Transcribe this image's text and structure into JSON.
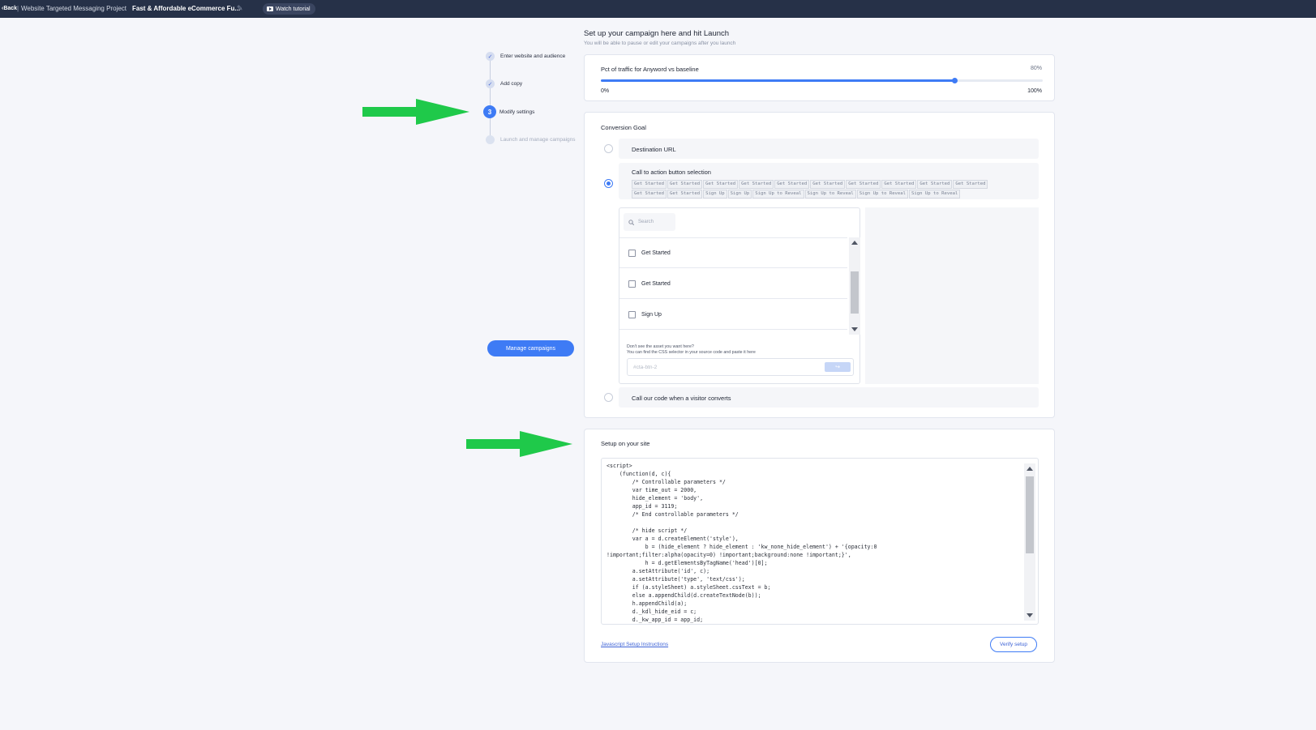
{
  "topbar": {
    "back": "‹Back",
    "separator": "|",
    "project": "Website Targeted Messaging Project",
    "campaign": "Fast & Affordable eCommerce Fu...",
    "watch_tutorial": "Watch tutorial",
    "icons": [
      "pencil-icon",
      "play-icon"
    ]
  },
  "stepper": {
    "steps": [
      {
        "label": "Enter website and audience",
        "state": "done",
        "marker": "✓"
      },
      {
        "label": "Add copy",
        "state": "done",
        "marker": "✓"
      },
      {
        "label": "Modify settings",
        "state": "active",
        "marker": "3"
      },
      {
        "label": "Launch and manage campaigns",
        "state": "upcoming",
        "marker": ""
      }
    ],
    "manage_button": "Manage campaigns"
  },
  "header": {
    "title": "Set up your campaign here and hit Launch",
    "subtitle": "You will be able to pause or edit your campaigns after you launch"
  },
  "traffic": {
    "label": "Pct of traffic for Anyword vs baseline",
    "value_label": "80%",
    "value": 0.8,
    "min_label": "0%",
    "max_label": "100%"
  },
  "conversion": {
    "title": "Conversion Goal",
    "options": {
      "destination": "Destination URL",
      "cta": "Call to action button selection",
      "code": "Call our code when a visitor converts"
    },
    "selected": "cta",
    "chips": [
      "Get Started",
      "Get Started",
      "Get Started",
      "Get Started",
      "Get Started",
      "Get Started",
      "Get Started",
      "Get Started",
      "Get Started",
      "Get Started",
      "Get Started",
      "Get Started",
      "Sign Up",
      "Sign Up",
      "Sign Up to Reveal",
      "Sign Up to Reveal",
      "Sign Up to Reveal",
      "Sign Up to Reveal"
    ],
    "search_placeholder": "Search",
    "list_items": [
      "Get Started",
      "Get Started",
      "Sign Up"
    ],
    "hint_line1": "Don't see the asset you want here?",
    "hint_line2": "You can find the CSS selector in your source code and paste it here",
    "css_placeholder": "#cta-btn-2",
    "css_go": "↪"
  },
  "setup": {
    "title": "Setup on your site",
    "code": "<script>\n    (function(d, c){\n        /* Controllable parameters */\n        var time_out = 2000,\n        hide_element = 'body',\n        app_id = 3119;\n        /* End controllable parameters */\n\n        /* hide script */\n        var a = d.createElement('style'),\n            b = (hide_element ? hide_element : 'kw_none_hide_element') + '{opacity:0\n!important;filter:alpha(opacity=0) !important;background:none !important;}',\n            h = d.getElementsByTagName('head')[0];\n        a.setAttribute('id', c);\n        a.setAttribute('type', 'text/css');\n        if (a.styleSheet) a.styleSheet.cssText = b;\n        else a.appendChild(d.createTextNode(b));\n        h.appendChild(a);\n        d._kdl_hide_eid = c;\n        d._kw_app_id = app_id;",
    "js_link": "Javascript Setup Instructions",
    "verify_button": "Verify setup"
  },
  "colors": {
    "topbar": "#263148",
    "accent": "#3e7bf5",
    "arrow": "#1fc94a"
  }
}
